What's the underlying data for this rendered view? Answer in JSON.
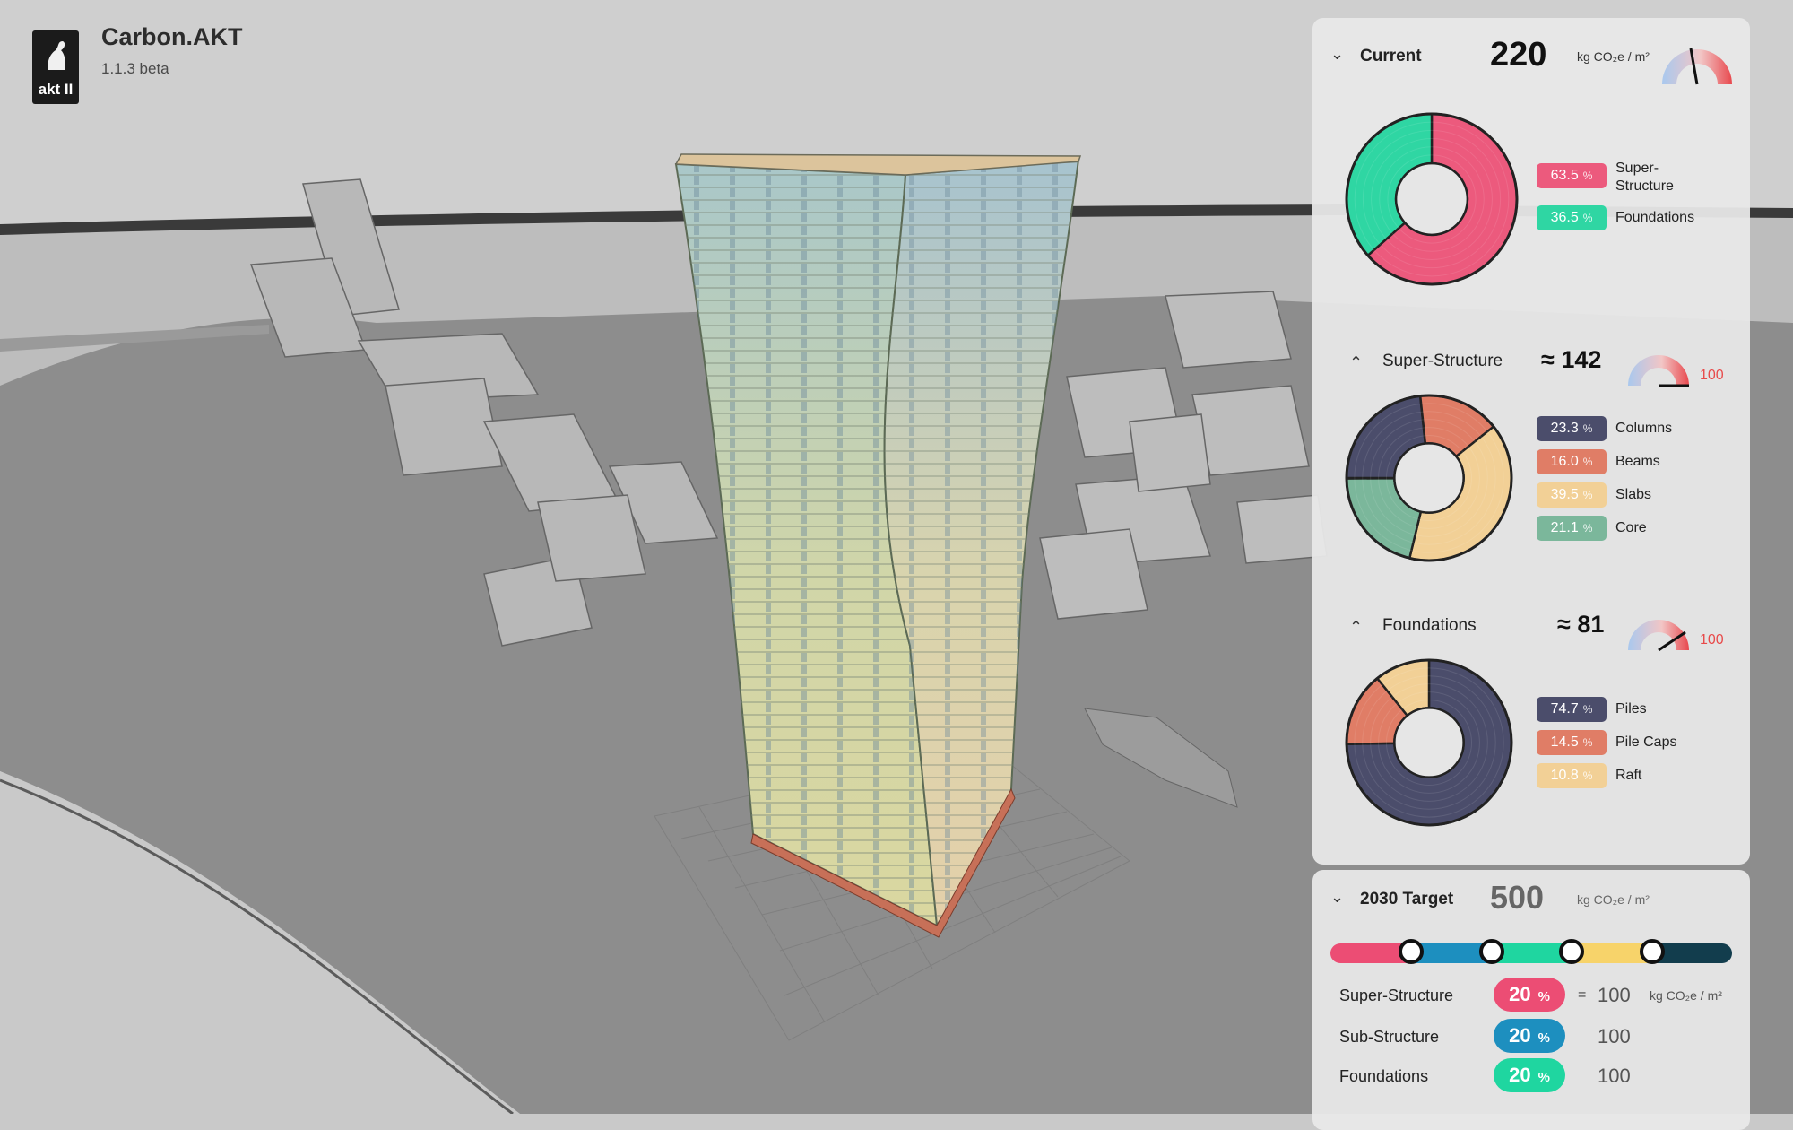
{
  "app": {
    "title": "Carbon.AKT",
    "version": "1.1.3 beta",
    "logo_text": "akt II"
  },
  "current": {
    "label": "Current",
    "value": "220",
    "unit": "kg CO₂e / m²",
    "gauge_icon": "gauge-icon",
    "breakdown": [
      {
        "pct": "63.5",
        "label": "Super-\nStructure",
        "color": "#ec5a7d"
      },
      {
        "pct": "36.5",
        "label": "Foundations",
        "color": "#2fd6a3"
      }
    ]
  },
  "superstructure": {
    "label": "Super-Structure",
    "approx": "≈ 142",
    "max": "100",
    "breakdown": [
      {
        "pct": "23.3",
        "label": "Columns",
        "color": "#4b4d6b"
      },
      {
        "pct": "16.0",
        "label": "Beams",
        "color": "#e07d66"
      },
      {
        "pct": "39.5",
        "label": "Slabs",
        "color": "#f2d096"
      },
      {
        "pct": "21.1",
        "label": "Core",
        "color": "#7bb79b"
      }
    ]
  },
  "foundations": {
    "label": "Foundations",
    "approx": "≈ 81",
    "max": "100",
    "breakdown": [
      {
        "pct": "74.7",
        "label": "Piles",
        "color": "#4b4d6b"
      },
      {
        "pct": "14.5",
        "label": "Pile Caps",
        "color": "#e07d66"
      },
      {
        "pct": "10.8",
        "label": "Raft",
        "color": "#f2d096"
      }
    ]
  },
  "target": {
    "label": "2030 Target",
    "value": "500",
    "unit": "kg CO₂e / m²",
    "bar_colors": [
      "#ec4d74",
      "#1d8fbf",
      "#1fd6a0",
      "#f7d36a",
      "#123d4d"
    ],
    "rows": [
      {
        "name": "Super-Structure",
        "pct": "20",
        "color": "#ec4d74",
        "eq": "=",
        "value": "100",
        "unit": "kg CO₂e / m²"
      },
      {
        "name": "Sub-Structure",
        "pct": "20",
        "color": "#1d8fbf",
        "eq": "",
        "value": "100",
        "unit": ""
      },
      {
        "name": "Foundations",
        "pct": "20",
        "color": "#1fd6a0",
        "eq": "",
        "value": "100",
        "unit": ""
      }
    ]
  },
  "symbols": {
    "percent": "%",
    "chevron_down": "⌄",
    "chevron_up": "⌃"
  }
}
